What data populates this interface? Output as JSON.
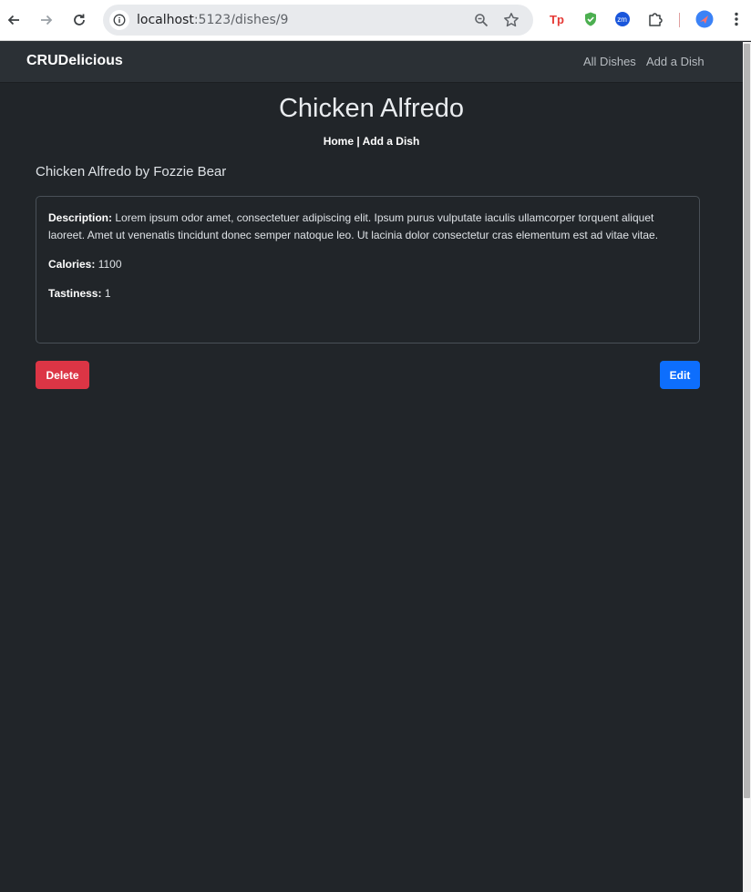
{
  "browser": {
    "url_host": "localhost",
    "url_path": ":5123/dishes/9"
  },
  "navbar": {
    "brand": "CRUDelicious",
    "links": [
      "All Dishes",
      "Add a Dish"
    ]
  },
  "page": {
    "title": "Chicken Alfredo",
    "crumb_home": "Home",
    "crumb_sep": " | ",
    "crumb_add": "Add a Dish",
    "subheading": "Chicken Alfredo by Fozzie Bear"
  },
  "dish": {
    "description_label": "Description:",
    "description": "Lorem ipsum odor amet, consectetuer adipiscing elit. Ipsum purus vulputate iaculis ullamcorper torquent aliquet laoreet. Amet ut venenatis tincidunt donec semper natoque leo. Ut lacinia dolor consectetur cras elementum est ad vitae vitae.",
    "calories_label": "Calories:",
    "calories": "1100",
    "tastiness_label": "Tastiness:",
    "tastiness": "1"
  },
  "actions": {
    "delete_label": "Delete",
    "edit_label": "Edit"
  },
  "colors": {
    "danger": "#dc3545",
    "primary": "#0d6efd",
    "background": "#212529",
    "navbar": "#2b3035"
  }
}
